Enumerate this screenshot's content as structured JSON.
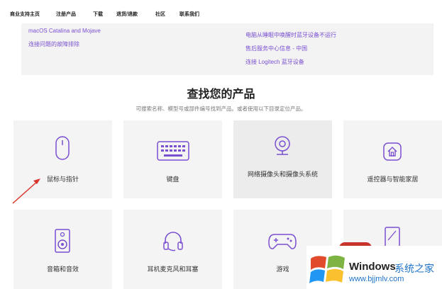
{
  "nav": {
    "items": [
      "商业支持主页",
      "注册产品",
      "下载",
      "退货/退款",
      "社区",
      "联系我们"
    ]
  },
  "support_links": {
    "left": [
      "macOS Catalina and Mojave",
      "连接问题的故障排除"
    ],
    "right": [
      "电脑从睡眠中唤醒时蓝牙设备不运行",
      "售后服务中心信息 - 中国",
      "连接 Logitech 蓝牙设备"
    ]
  },
  "section": {
    "title": "查找您的产品",
    "subtitle": "可搜索名称、模型号或部件编号找到产品。或者使用以下目录定位产品。"
  },
  "categories": [
    {
      "label": "鼠标与指针",
      "icon": "mouse-icon"
    },
    {
      "label": "键盘",
      "icon": "keyboard-icon"
    },
    {
      "label": "网络摄像头和摄像头系统",
      "icon": "webcam-icon"
    },
    {
      "label": "遥控器与智能家居",
      "icon": "smart-home-icon"
    },
    {
      "label": "音箱和音效",
      "icon": "speaker-icon"
    },
    {
      "label": "耳机麦克风和耳塞",
      "icon": "headset-icon"
    },
    {
      "label": "游戏",
      "icon": "gamepad-icon"
    },
    {
      "label": "",
      "icon": "tablet-icon"
    }
  ],
  "watermark": {
    "brand": "Windows",
    "site_name": "系统之家",
    "url": "www.bjjmlv.com"
  },
  "colors": {
    "accent": "#7a4fd1",
    "card_bg": "#f4f4f4",
    "arrow": "#d9342b"
  }
}
